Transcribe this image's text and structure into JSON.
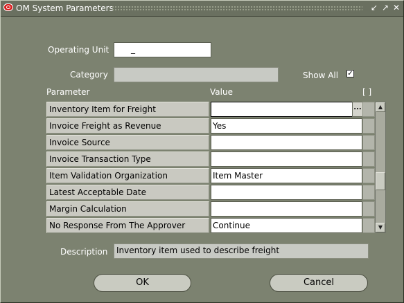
{
  "window": {
    "title": "OM System Parameters",
    "controls": {
      "minimize": "↙",
      "maximize": "↗",
      "close": "✕"
    }
  },
  "form": {
    "operating_unit_label": "Operating Unit",
    "operating_unit_value": "_",
    "category_label": "Category",
    "category_value": "",
    "show_all_label": "Show All",
    "show_all_checked": "✓"
  },
  "table": {
    "param_header": "Parameter",
    "value_header": "Value",
    "extra_header": "[ ]",
    "lov_label": "...",
    "rows": [
      {
        "parameter": "Inventory Item for Freight",
        "value": ""
      },
      {
        "parameter": "Invoice Freight as Revenue",
        "value": "Yes"
      },
      {
        "parameter": "Invoice Source",
        "value": ""
      },
      {
        "parameter": "Invoice Transaction Type",
        "value": ""
      },
      {
        "parameter": "Item Validation Organization",
        "value": "Item Master"
      },
      {
        "parameter": "Latest Acceptable Date",
        "value": ""
      },
      {
        "parameter": "Margin Calculation",
        "value": ""
      },
      {
        "parameter": "No Response From The Approver",
        "value": "Continue"
      }
    ]
  },
  "description": {
    "label": "Description",
    "value": "Inventory item used to describe freight"
  },
  "buttons": {
    "ok_label": "OK",
    "cancel_label": "Cancel"
  }
}
